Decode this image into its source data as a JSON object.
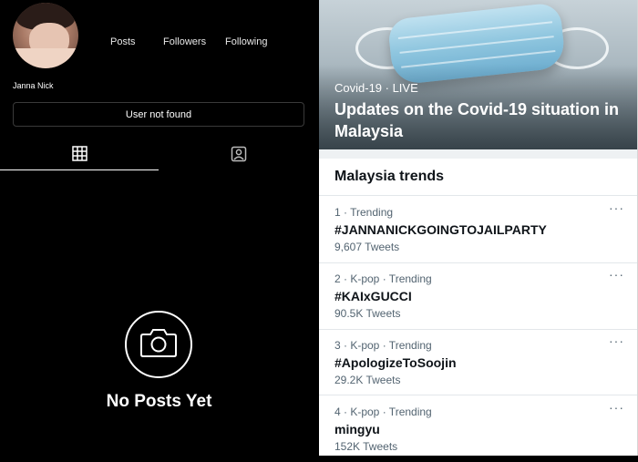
{
  "profile": {
    "username": "Janna Nick",
    "stats": {
      "posts_label": "Posts",
      "followers_label": "Followers",
      "following_label": "Following"
    },
    "status_button": "User not found",
    "tabs": [
      {
        "icon": "grid-icon",
        "selected": true
      },
      {
        "icon": "tagged-person-icon",
        "selected": false
      }
    ],
    "empty_state": {
      "icon": "camera-icon",
      "text": "No Posts Yet"
    }
  },
  "trends_panel": {
    "hero": {
      "kicker": "Covid-19 · LIVE",
      "title": "Updates on the Covid-19 situation in Malaysia"
    },
    "heading": "Malaysia trends",
    "more_glyph": "···",
    "items": [
      {
        "meta": "1 · Trending",
        "topic": "#JANNANICKGOINGTOJAILPARTY",
        "count": "9,607 Tweets"
      },
      {
        "meta": "2 · K-pop · Trending",
        "topic": "#KAIxGUCCI",
        "count": "90.5K Tweets"
      },
      {
        "meta": "3 · K-pop · Trending",
        "topic": "#ApologizeToSoojin",
        "count": "29.2K Tweets"
      },
      {
        "meta": "4 · K-pop · Trending",
        "topic": "mingyu",
        "count": "152K Tweets"
      }
    ]
  },
  "colors": {
    "profile_bg": "#000000",
    "trends_bg": "#ffffff",
    "secondary_text": "#536471"
  }
}
